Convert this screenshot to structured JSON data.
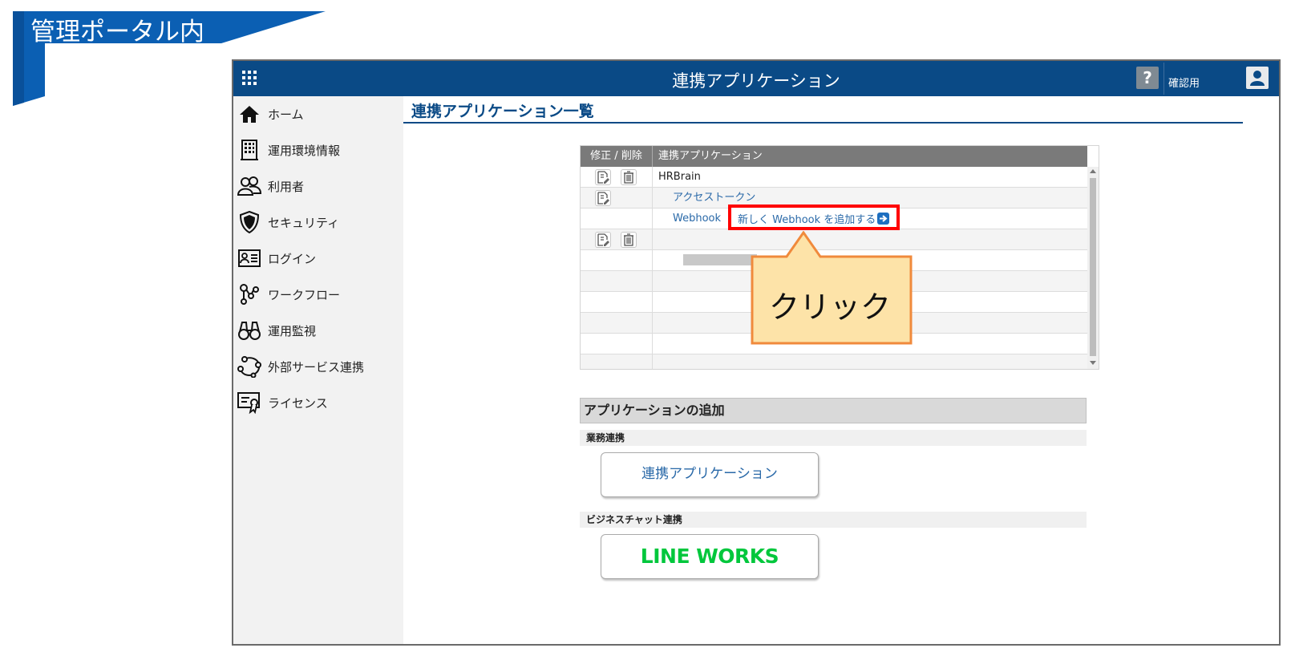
{
  "annotation": {
    "ribbon_label": "管理ポータル内",
    "callout_text": "クリック"
  },
  "header": {
    "title": "連携アプリケーション",
    "help": "?",
    "user": "確認用"
  },
  "sidebar": {
    "items": [
      {
        "label": "ホーム",
        "icon": "home-icon"
      },
      {
        "label": "運用環境情報",
        "icon": "building-icon"
      },
      {
        "label": "利用者",
        "icon": "users-icon"
      },
      {
        "label": "セキュリティ",
        "icon": "shield-icon"
      },
      {
        "label": "ログイン",
        "icon": "id-card-icon"
      },
      {
        "label": "ワークフロー",
        "icon": "workflow-icon"
      },
      {
        "label": "運用監視",
        "icon": "binoculars-icon"
      },
      {
        "label": "外部サービス連携",
        "icon": "network-icon"
      },
      {
        "label": "ライセンス",
        "icon": "certificate-icon"
      }
    ]
  },
  "main": {
    "page_title": "連携アプリケーション一覧",
    "table": {
      "col_edit": "修正 / 削除",
      "col_app": "連携アプリケーション",
      "rows": [
        {
          "app": "HRBrain"
        },
        {
          "app": "アクセストークン"
        },
        {
          "app": "Webhook"
        }
      ],
      "webhook_add": "新しく Webhook を追加する"
    },
    "add_section": {
      "title": "アプリケーションの追加",
      "business_header": "業務連携",
      "business_button": "連携アプリケーション",
      "chat_header": "ビジネスチャット連携",
      "chat_button": "LINE WORKS"
    }
  },
  "colors": {
    "header_bg": "#0a4a86",
    "highlight": "#ff0000",
    "callout_fill": "#fde3a8",
    "callout_border": "#f08a3c",
    "line_works": "#00c73c"
  }
}
